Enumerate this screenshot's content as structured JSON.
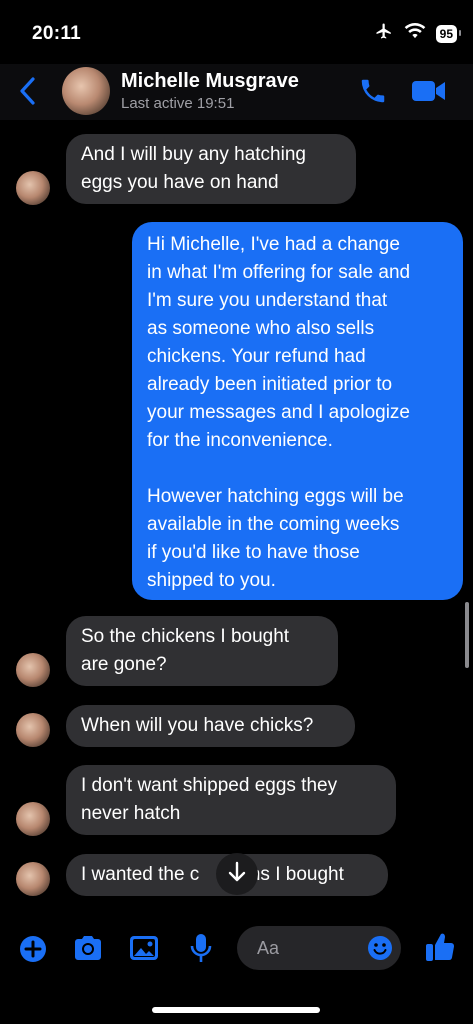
{
  "status_bar": {
    "time": "20:11",
    "battery": "95"
  },
  "header": {
    "name": "Michelle Musgrave",
    "subtitle": "Last active 19:51"
  },
  "messages": [
    {
      "from": "them",
      "lines": [
        "And I will buy any hatching",
        "eggs you have on hand"
      ]
    },
    {
      "from": "me",
      "lines": [
        "Hi Michelle, I've had a change",
        "in what I'm offering for sale and",
        "I'm sure you understand that",
        "as someone who also sells",
        "chickens. Your refund had",
        "already been initiated prior to",
        "your messages and I apologize",
        "for the inconvenience.",
        "",
        "However hatching eggs will be",
        "available in the coming weeks",
        "if you'd like to have those",
        "shipped to you."
      ]
    },
    {
      "from": "them",
      "lines": [
        "So the chickens I bought",
        "are gone?"
      ]
    },
    {
      "from": "them",
      "lines": [
        "When will you have chicks?"
      ]
    },
    {
      "from": "them",
      "lines": [
        "I don't want shipped eggs they",
        "never hatch"
      ]
    },
    {
      "from": "them",
      "lines": [
        "I wanted the c",
        "ens I bought"
      ]
    }
  ],
  "composer": {
    "placeholder": "Aa"
  },
  "icons": {
    "back": "chevron-left-icon",
    "call": "phone-icon",
    "video": "video-camera-icon",
    "add": "plus-circle-icon",
    "camera": "camera-icon",
    "gallery": "image-icon",
    "mic": "microphone-icon",
    "emoji": "smiley-icon",
    "like": "thumbs-up-icon",
    "scroll": "arrow-down-icon"
  },
  "colors": {
    "accent": "#1a6ff5",
    "incoming_bubble": "#303033",
    "background": "#000000"
  }
}
